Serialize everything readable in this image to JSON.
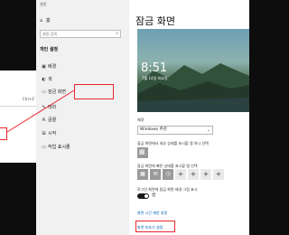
{
  "left_menu": {
    "items": [
      {
        "label": "",
        "shortcut": ""
      },
      {
        "label": "",
        "shortcut": "Ctrl+Z"
      },
      {
        "label": "",
        "shortcut": ""
      },
      {
        "label": "",
        "shortcut": ""
      },
      {
        "label": "",
        "shortcut": ""
      }
    ]
  },
  "window": {
    "title": "설정"
  },
  "nav": {
    "home": "홈",
    "search_placeholder": "설정 검색",
    "section": "개인 설정",
    "items": [
      {
        "label": "배경",
        "icon": "image-icon"
      },
      {
        "label": "색",
        "icon": "palette-icon"
      },
      {
        "label": "잠금 화면",
        "icon": "lock-screen-icon"
      },
      {
        "label": "테마",
        "icon": "brush-icon"
      },
      {
        "label": "글꼴",
        "icon": "font-icon"
      },
      {
        "label": "시작",
        "icon": "start-icon"
      },
      {
        "label": "작업 표시줄",
        "icon": "taskbar-icon"
      }
    ]
  },
  "content": {
    "title": "잠금 화면",
    "preview_time": "8:51",
    "preview_date": "7월 14일 화요일",
    "background_label": "배경",
    "background_value": "Windows 추천",
    "detail_label": "잠금 화면에서 세부 상태를 표시할 앱 하나 선택",
    "quick_label": "잠금 화면에 빠른 상태를 표시할 앱 선택",
    "signin_label": "로그인 화면에 잠금 화면 배경 그림 표시",
    "toggle_state": "켬",
    "timeout_link": "화면 시간 제한 설정",
    "saver_link": "화면 보호기 설정"
  },
  "colors": {
    "highlight": "#e8262c",
    "link": "#0063b1"
  }
}
